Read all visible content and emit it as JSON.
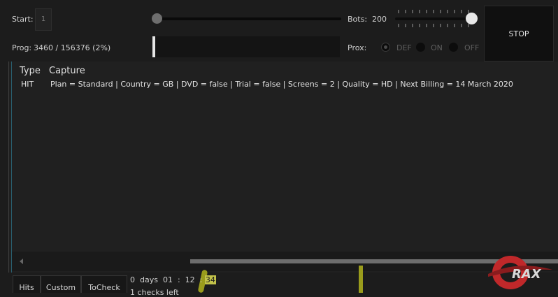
{
  "controls": {
    "start_label": "Start:",
    "start_value": "1",
    "prog_label": "Prog:",
    "prog_text": "3460 / 156376 (2%)",
    "progress_fraction": 0.022,
    "bots_label": "Bots:",
    "bots_value": "200",
    "prox_label": "Prox:",
    "prox_options": [
      "DEF",
      "ON",
      "OFF"
    ],
    "prox_selected": "DEF",
    "stop_label": "STOP"
  },
  "table": {
    "columns": [
      "Type",
      "Capture"
    ],
    "rows": [
      {
        "type": "HIT",
        "capture": "Plan = Standard | Country = GB | DVD = false | Trial = false | Screens = 2 | Quality = HD | Next Billing = 14 March 2020"
      }
    ]
  },
  "tabs": [
    "Hits",
    "Custom",
    "ToCheck"
  ],
  "timer": {
    "prefix": "0  days  01  :  12  : ",
    "seconds": "34",
    "second_line": "1 checks left"
  },
  "icons": {
    "scroll_left": "triangle-left-icon",
    "logo": "crax-logo"
  },
  "colors": {
    "background": "#1c1c1c",
    "panel": "#202020",
    "accent_teal": "#2a5f6f",
    "logo_red": "#c0282a",
    "highlight": "#c2c24a"
  }
}
